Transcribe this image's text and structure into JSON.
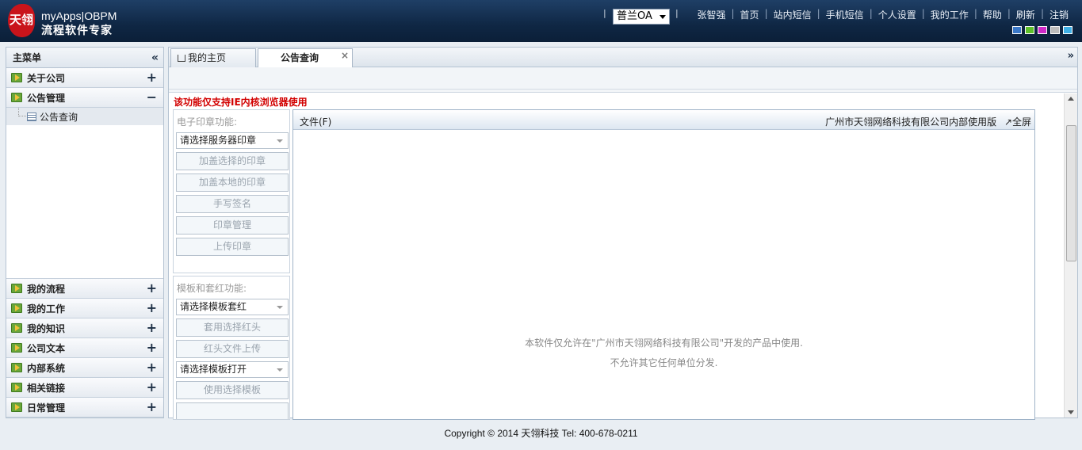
{
  "header": {
    "logo_mark": "天翎",
    "logo_line1": "myApps|OBPM",
    "logo_line2": "流程软件专家",
    "company": "普兰OA",
    "nav": [
      "张智强",
      "首页",
      "站内短信",
      "手机短信",
      "个人设置",
      "我的工作",
      "帮助",
      "刷新",
      "注销"
    ],
    "swatches": [
      "#3a78c8",
      "#5ec02a",
      "#d02ac8",
      "#bdbdbd",
      "#3fb0e6"
    ]
  },
  "sidebar": {
    "title": "主菜单",
    "collapse_icon": "«",
    "top_items": [
      {
        "label": "关于公司",
        "toggle": "+"
      },
      {
        "label": "公告管理",
        "toggle": "−"
      }
    ],
    "sub_item": "公告查询",
    "bottom_items": [
      {
        "label": "我的流程",
        "toggle": "+"
      },
      {
        "label": "我的工作",
        "toggle": "+"
      },
      {
        "label": "我的知识",
        "toggle": "+"
      },
      {
        "label": "公司文本",
        "toggle": "+"
      },
      {
        "label": "内部系统",
        "toggle": "+"
      },
      {
        "label": "相关链接",
        "toggle": "+"
      },
      {
        "label": "日常管理",
        "toggle": "+"
      }
    ]
  },
  "tabs": {
    "home": "我的主页",
    "active": "公告查询",
    "close": "×",
    "menu": "»"
  },
  "content": {
    "warning": "该功能仅支持IE内核浏览器使用",
    "seal_panel": {
      "title": "电子印章功能:",
      "select": "请选择服务器印章",
      "buttons": [
        "加盖选择的印章",
        "加盖本地的印章",
        "手写签名",
        "印章管理",
        "上传印章"
      ]
    },
    "template_panel": {
      "title": "模板和套红功能:",
      "select1": "请选择模板套红",
      "buttons1": [
        "套用选择红头",
        "红头文件上传"
      ],
      "select2": "请选择模板打开",
      "buttons2": [
        "使用选择模板"
      ]
    },
    "doc": {
      "menu": "文件(F)",
      "info": "广州市天翎网络科技有限公司内部使用版",
      "fullscreen": "↗全屏",
      "notice1": "本软件仅允许在\"广州市天翎网络科技有限公司\"开发的产品中使用.",
      "notice2": "不允许其它任何单位分发."
    }
  },
  "footer": "Copyright © 2014 天翎科技  Tel: 400-678-0211"
}
